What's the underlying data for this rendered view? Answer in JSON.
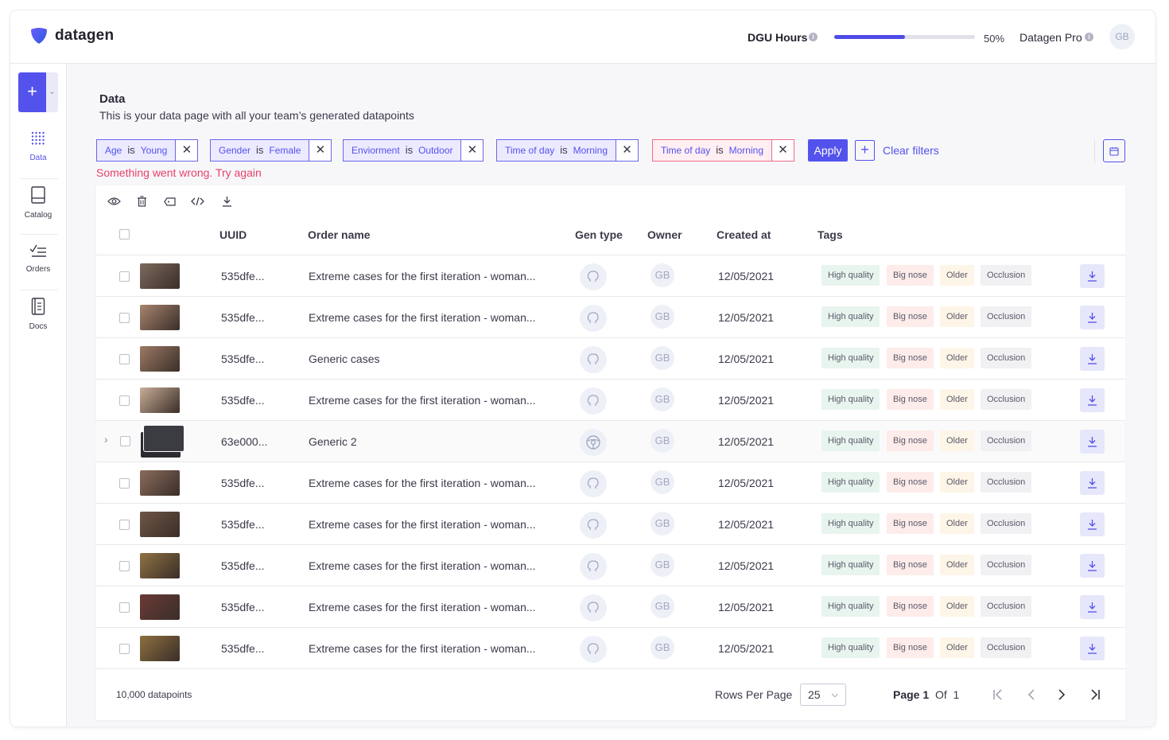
{
  "brand": {
    "name": "datagen",
    "color": "#5352ec"
  },
  "header": {
    "usage_label": "DGU Hours",
    "usage_percent": 50,
    "usage_percent_label": "50%",
    "plan_label": "Datagen Pro",
    "user_initials": "GB"
  },
  "sidebar": {
    "add_label": "+",
    "items": [
      {
        "label": "Data",
        "icon": "grid-dots-icon",
        "active": true
      },
      {
        "label": "Catalog",
        "icon": "book-icon",
        "active": false
      },
      {
        "label": "Orders",
        "icon": "checklist-icon",
        "active": false
      },
      {
        "label": "Docs",
        "icon": "document-icon",
        "active": false
      }
    ]
  },
  "page": {
    "title": "Data",
    "subtitle": "This is your data page with all your team’s generated datapoints"
  },
  "filters": [
    {
      "field": "Age",
      "op": "is",
      "value": "Young",
      "error": false
    },
    {
      "field": "Gender",
      "op": "is",
      "value": "Female",
      "error": false
    },
    {
      "field": "Enviorment",
      "op": "is",
      "value": "Outdoor",
      "error": false
    },
    {
      "field": "Time of day",
      "op": "is",
      "value": "Morning",
      "error": false
    },
    {
      "field": "Time of day",
      "op": "is",
      "value": "Morning",
      "error": true
    }
  ],
  "filter_actions": {
    "apply_label": "Apply",
    "add_label": "+",
    "clear_label": "Clear filters",
    "close_glyph": "✕"
  },
  "error_message": "Something went wrong. Try again",
  "table": {
    "toolbar": [
      "eye-icon",
      "trash-icon",
      "tag-icon",
      "code-icon",
      "download-icon"
    ],
    "columns": {
      "uuid": "UUID",
      "order_name": "Order name",
      "gen_type": "Gen type",
      "owner": "Owner",
      "created_at": "Created at",
      "tags": "Tags"
    },
    "rows": [
      {
        "uuid": "535dfe...",
        "order_name": "Extreme cases for the first iteration - woman...",
        "gen_type": "head-icon",
        "owner": "GB",
        "created_at": "12/05/2021",
        "tags": [
          "High quality",
          "Big nose",
          "Older",
          "Occlusion"
        ],
        "thumb_color": "#7c6a5e",
        "expandable": false
      },
      {
        "uuid": "535dfe...",
        "order_name": "Extreme cases for the first iteration - woman...",
        "gen_type": "head-icon",
        "owner": "GB",
        "created_at": "12/05/2021",
        "tags": [
          "High quality",
          "Big nose",
          "Older",
          "Occlusion"
        ],
        "thumb_color": "#a7846f",
        "expandable": false
      },
      {
        "uuid": "535dfe...",
        "order_name": "Generic cases",
        "gen_type": "head-icon",
        "owner": "GB",
        "created_at": "12/05/2021",
        "tags": [
          "High quality",
          "Big nose",
          "Older",
          "Occlusion"
        ],
        "thumb_color": "#9d7a66",
        "expandable": false
      },
      {
        "uuid": "535dfe...",
        "order_name": "Extreme cases for the first iteration - woman...",
        "gen_type": "head-icon",
        "owner": "GB",
        "created_at": "12/05/2021",
        "tags": [
          "High quality",
          "Big nose",
          "Older",
          "Occlusion"
        ],
        "thumb_color": "#c9ad98",
        "expandable": false
      },
      {
        "uuid": "63e000...",
        "order_name": "Generic 2",
        "gen_type": "steering-wheel-icon",
        "owner": "GB",
        "created_at": "12/05/2021",
        "tags": [
          "High quality",
          "Big nose",
          "Older",
          "Occlusion"
        ],
        "thumb_color": "#3b3b42",
        "expandable": true
      },
      {
        "uuid": "535dfe...",
        "order_name": "Extreme cases for the first iteration - woman...",
        "gen_type": "head-icon",
        "owner": "GB",
        "created_at": "12/05/2021",
        "tags": [
          "High quality",
          "Big nose",
          "Older",
          "Occlusion"
        ],
        "thumb_color": "#8a6c5c",
        "expandable": false
      },
      {
        "uuid": "535dfe...",
        "order_name": "Extreme cases for the first iteration - woman...",
        "gen_type": "head-icon",
        "owner": "GB",
        "created_at": "12/05/2021",
        "tags": [
          "High quality",
          "Big nose",
          "Older",
          "Occlusion"
        ],
        "thumb_color": "#6f5646",
        "expandable": false
      },
      {
        "uuid": "535dfe...",
        "order_name": "Extreme cases for the first iteration - woman...",
        "gen_type": "head-icon",
        "owner": "GB",
        "created_at": "12/05/2021",
        "tags": [
          "High quality",
          "Big nose",
          "Older",
          "Occlusion"
        ],
        "thumb_color": "#8f7244",
        "expandable": false
      },
      {
        "uuid": "535dfe...",
        "order_name": "Extreme cases for the first iteration - woman...",
        "gen_type": "head-icon",
        "owner": "GB",
        "created_at": "12/05/2021",
        "tags": [
          "High quality",
          "Big nose",
          "Older",
          "Occlusion"
        ],
        "thumb_color": "#6a3a36",
        "expandable": false
      },
      {
        "uuid": "535dfe...",
        "order_name": "Extreme cases for the first iteration - woman...",
        "gen_type": "head-icon",
        "owner": "GB",
        "created_at": "12/05/2021",
        "tags": [
          "High quality",
          "Big nose",
          "Older",
          "Occlusion"
        ],
        "thumb_color": "#8d7040",
        "expandable": false
      }
    ]
  },
  "pagination": {
    "count_label": "10,000 datapoints",
    "rows_per_page_label": "Rows Per Page",
    "rows_per_page": "25",
    "page_label": "Page",
    "page": "1",
    "of_label": "Of",
    "total_pages": "1"
  }
}
